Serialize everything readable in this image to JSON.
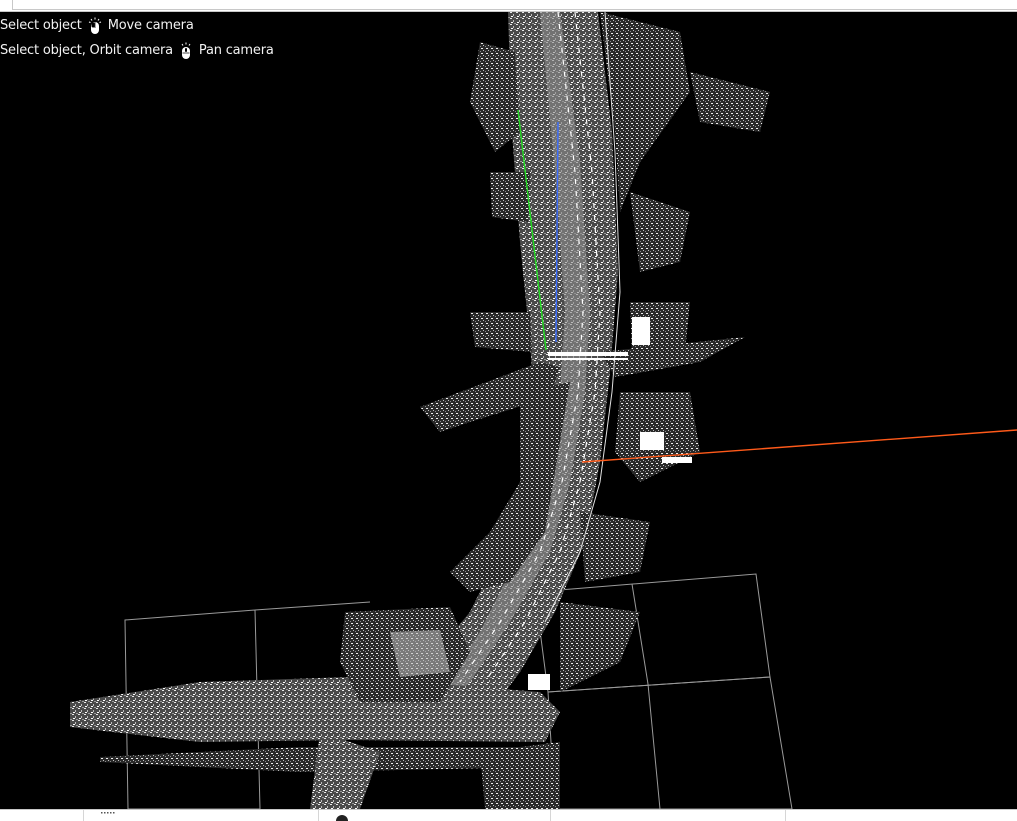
{
  "hints": {
    "line1": {
      "left_action": "Select object",
      "right_action": "Move camera"
    },
    "line2": {
      "left_action": "Select object, Orbit camera",
      "right_action": "Pan camera"
    }
  },
  "icons": {
    "mouse_left": "mouse-left-click-icon",
    "mouse_wheel": "mouse-wheel-icon",
    "grip": "grip-handle-icon",
    "dot": "status-dot-icon"
  },
  "colors": {
    "background": "#000000",
    "point_cloud": "#d9d9d9",
    "axis_x": "#ff5a1a",
    "axis_y": "#22dd22",
    "axis_z": "#3a6cff",
    "grid": "#9a9a9a"
  }
}
